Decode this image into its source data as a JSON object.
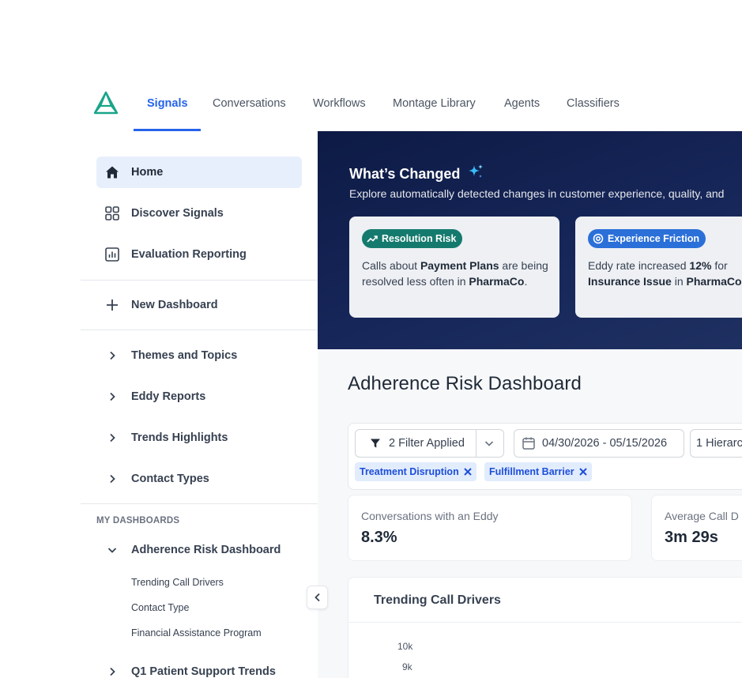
{
  "nav": {
    "tabs": [
      {
        "label": "Signals",
        "active": true
      },
      {
        "label": "Conversations"
      },
      {
        "label": "Workflows"
      },
      {
        "label": "Montage Library"
      },
      {
        "label": "Agents"
      },
      {
        "label": "Classifiers"
      }
    ],
    "accent": "#2563eb"
  },
  "sidebar": {
    "primary": [
      {
        "label": "Home",
        "icon": "home-icon",
        "active": true
      },
      {
        "label": "Discover Signals",
        "icon": "grid-icon"
      },
      {
        "label": "Evaluation Reporting",
        "icon": "bar-chart-icon"
      }
    ],
    "new_dashboard": "New Dashboard",
    "groups": [
      {
        "label": "Themes and Topics"
      },
      {
        "label": "Eddy Reports"
      },
      {
        "label": "Trends Highlights"
      },
      {
        "label": "Contact Types"
      }
    ],
    "my_dashboards_heading": "MY DASHBOARDS",
    "dashboard": {
      "label": "Adherence Risk Dashboard",
      "children": [
        "Trending Call Drivers",
        "Contact Type",
        "Financial Assistance Program"
      ]
    },
    "next_dashboard": "Q1 Patient Support Trends"
  },
  "hero": {
    "title": "What’s Changed",
    "subtitle": "Explore automatically detected changes in customer experience, quality, and",
    "cards": [
      {
        "badge": "Resolution Risk",
        "badge_color": "#157a6e",
        "text_parts": [
          "Calls about ",
          "Payment Plans",
          " are being resolved less often in ",
          "PharmaCo",
          "."
        ]
      },
      {
        "badge": "Experience Friction",
        "badge_color": "#2b6fd8",
        "text_parts": [
          "Eddy rate increased ",
          "12%",
          " for ",
          "Insurance Issue",
          " in ",
          "PharmaCo"
        ]
      }
    ]
  },
  "dashboard": {
    "title": "Adherence Risk Dashboard",
    "filter_button": "2 Filter Applied",
    "date_range": "04/30/2026 - 05/15/2026",
    "hierarchy": "1 Hierarch",
    "tags": [
      "Treatment Disruption",
      "Fulfillment Barrier"
    ],
    "stats": [
      {
        "label": "Conversations with an Eddy",
        "value": "8.3%"
      },
      {
        "label": "Average Call D",
        "value": "3m 29s"
      }
    ],
    "chart": {
      "title": "Trending Call Drivers",
      "y_ticks": [
        "10k",
        "9k"
      ]
    }
  }
}
